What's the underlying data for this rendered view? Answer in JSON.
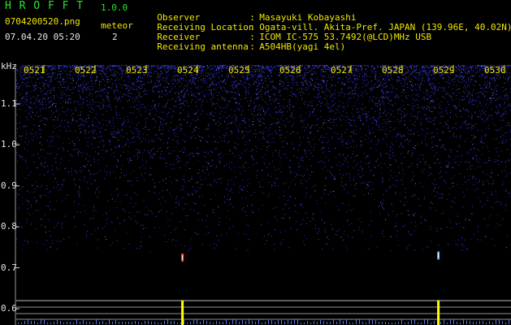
{
  "header": {
    "app_title": "H R O F F T",
    "app_version": "1.0.0",
    "filename": "0704200520.png",
    "meteor_label": "meteor",
    "meteor_count": "2",
    "datetime": "07.04.20 05:20"
  },
  "station": [
    {
      "label": "Observer",
      "sep": ":",
      "value": "Masayuki Kobayashi"
    },
    {
      "label": "Receiving Location",
      "sep": ":",
      "value": "Ogata-vill. Akita-Pref. JAPAN (139.96E, 40.02N)"
    },
    {
      "label": "Receiver",
      "sep": ":",
      "value": "ICOM IC-575 53.7492(@LCD)MHz USB"
    },
    {
      "label": "Receiving antenna",
      "sep": ":",
      "value": "A504HB(yagi 4el)"
    }
  ],
  "chart_data": {
    "type": "heatmap",
    "ylabel": "kHz",
    "x_ticks": [
      "0521",
      "0522",
      "0523",
      "0524",
      "0525",
      "0526",
      "0527",
      "0528",
      "0529",
      "0530"
    ],
    "y_ticks": [
      "1.1",
      "1.0",
      "0.9",
      "0.8",
      "0.7",
      "0.6"
    ],
    "y_tick_values": [
      1.1,
      1.0,
      0.9,
      0.8,
      0.7,
      0.6
    ],
    "meteor_echoes": [
      {
        "time": "0523.7",
        "freq_khz": 0.725
      },
      {
        "time": "0528.7",
        "freq_khz": 0.73
      }
    ],
    "colors": {
      "noise": "#3a3adf",
      "grid": "#ffffff",
      "signal": "#ffff00",
      "echo": "#ff4040"
    }
  }
}
